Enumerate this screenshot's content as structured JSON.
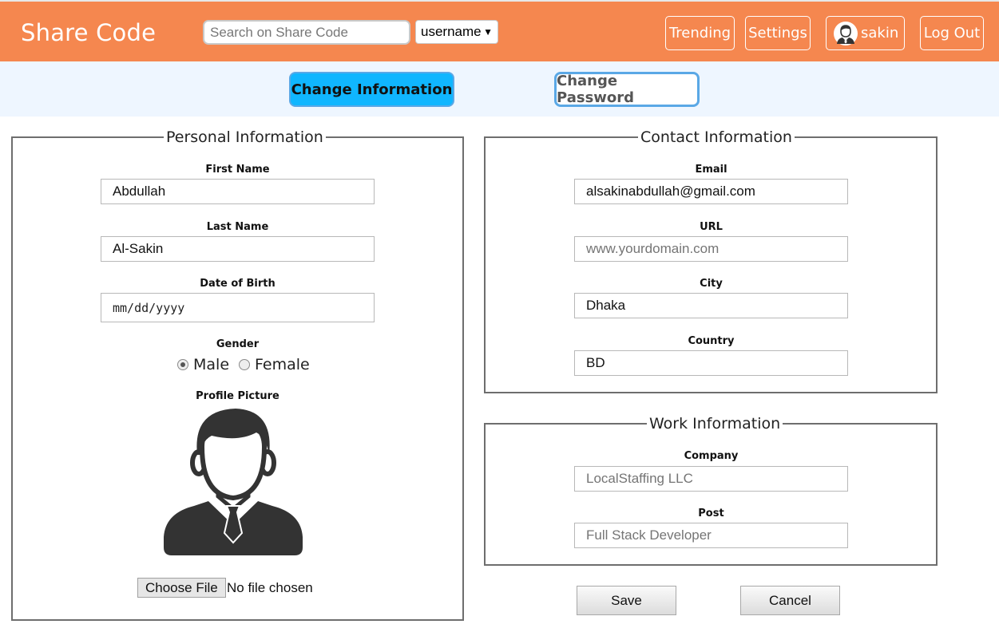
{
  "header": {
    "brand": "Share Code",
    "search_placeholder": "Search on Share Code",
    "search_value": "",
    "search_type": "username",
    "nav": {
      "trending": "Trending",
      "settings": "Settings",
      "profile": "sakin",
      "logout": "Log Out"
    }
  },
  "tabs": {
    "change_information": "Change Information",
    "change_password": "Change Password"
  },
  "personal": {
    "legend": "Personal Information",
    "first_name_label": "First Name",
    "first_name": "Abdullah",
    "last_name_label": "Last Name",
    "last_name": "Al-Sakin",
    "dob_label": "Date of Birth",
    "dob_placeholder": "mm/dd/yyyy",
    "gender_label": "Gender",
    "gender_options": [
      "Male",
      "Female"
    ],
    "gender_selected": "Male",
    "profile_picture_label": "Profile Picture",
    "choose_file": "Choose File",
    "file_status": "No file chosen"
  },
  "contact": {
    "legend": "Contact Information",
    "email_label": "Email",
    "email": "alsakinabdullah@gmail.com",
    "url_label": "URL",
    "url": "",
    "url_placeholder": "www.yourdomain.com",
    "city_label": "City",
    "city": "Dhaka",
    "country_label": "Country",
    "country": "BD"
  },
  "work": {
    "legend": "Work Information",
    "company_label": "Company",
    "company": "",
    "company_placeholder": "LocalStaffing LLC",
    "post_label": "Post",
    "post": "",
    "post_placeholder": "Full Stack Developer"
  },
  "actions": {
    "save": "Save",
    "cancel": "Cancel"
  },
  "colors": {
    "header_bg": "#f5874f",
    "tabstrip_bg": "#eef6ff",
    "active_tab": "#10b6ff",
    "tab_border": "#5aa8e6"
  }
}
